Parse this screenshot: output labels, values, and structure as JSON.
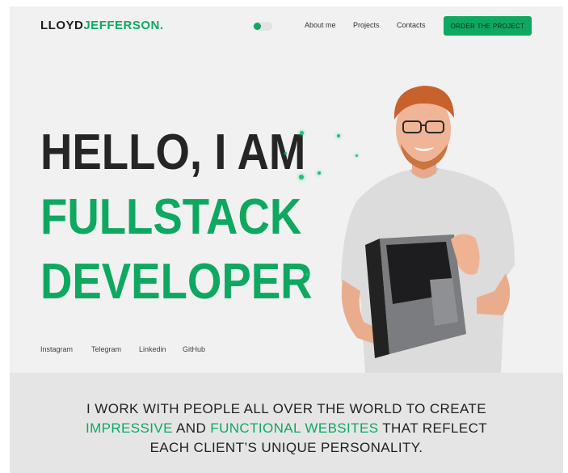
{
  "header": {
    "logo_first": "LLOYD",
    "logo_second": "JEFFERSON.",
    "nav": [
      "About me",
      "Projects",
      "Contacts"
    ],
    "cta_label": "ORDER THE PROJECT"
  },
  "hero": {
    "line1": "HELLO, I AM",
    "line2": "FULLSTACK",
    "line3": "DEVELOPER"
  },
  "social": [
    "Instagram",
    "Telegram",
    "Linkedin",
    "GitHub"
  ],
  "tagline": {
    "part1": "I WORK WITH PEOPLE ALL OVER THE WORLD TO CREATE",
    "highlight1": "IMPRESSIVE",
    "and": " AND ",
    "highlight2": "FUNCTIONAL WEBSITES",
    "part2": " THAT REFLECT",
    "part3": "EACH CLIENT’S UNIQUE PERSONALITY."
  },
  "theme": {
    "accent": "#0ea861",
    "dark": "#252525",
    "background": "#f1f1f1"
  }
}
